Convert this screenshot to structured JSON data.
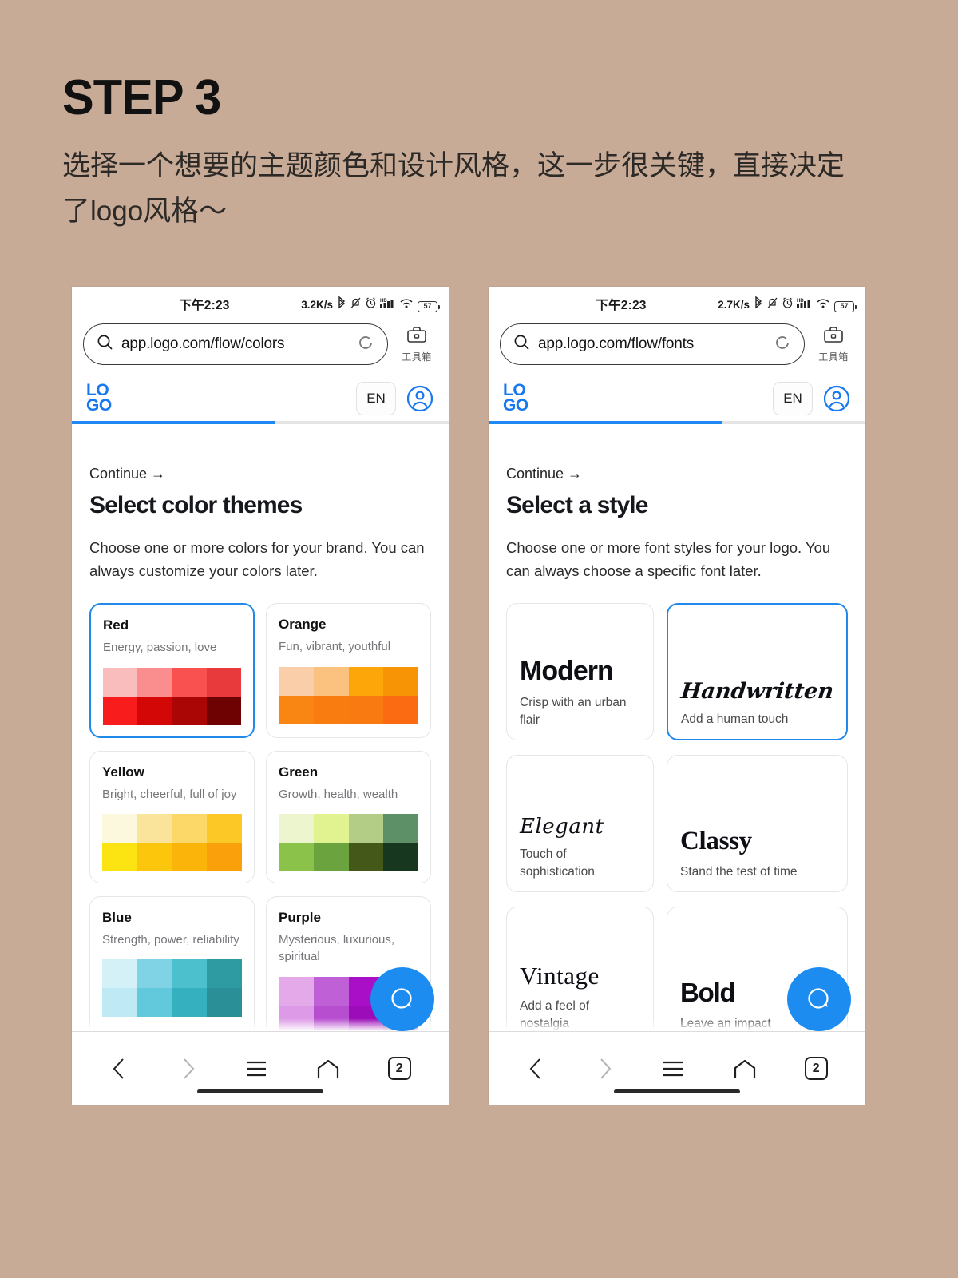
{
  "hero": {
    "step": "STEP 3",
    "subtitle": "选择一个想要的主题颜色和设计风格，这一步很关键，直接决定了logo风格～"
  },
  "phone_left": {
    "status": {
      "time": "下午2:23",
      "net_speed": "3.2K/s",
      "battery": "57",
      "hd_label": "HD"
    },
    "browser": {
      "url": "app.logo.com/flow/colors",
      "toolbox_label": "工具箱"
    },
    "app_header": {
      "logo_top": "LO",
      "logo_bottom": "GO",
      "lang": "EN"
    },
    "progress_percent": 54,
    "accent_color": "#1f88f2",
    "page": {
      "continue_label": "Continue →",
      "title": "Select color themes",
      "description": "Choose one or more colors for your brand. You can always customize your colors later."
    },
    "color_cards": [
      {
        "name": "Red",
        "desc": "Energy, passion, love",
        "selected": true,
        "swatches": [
          "#f9bdbd",
          "#fa8e8e",
          "#f9514f",
          "#e8393c",
          "#f81c1c",
          "#d40707",
          "#ab0606",
          "#6e0202"
        ]
      },
      {
        "name": "Orange",
        "desc": "Fun, vibrant, youthful",
        "selected": false,
        "swatches": [
          "#f9ceа8",
          "#fbc27f",
          "#fca60a",
          "#f79406",
          "#f98612",
          "#f97c10",
          "#fa7a12",
          "#fb6b12"
        ]
      },
      {
        "name": "Yellow",
        "desc": "Bright, cheerful, full of joy",
        "selected": false,
        "swatches": [
          "#fbf8dd",
          "#fae39a",
          "#fbd868",
          "#fbc825",
          "#fbe411",
          "#fcc60c",
          "#fbb50a",
          "#faa00a"
        ]
      },
      {
        "name": "Green",
        "desc": "Growth, health, wealth",
        "selected": false,
        "swatches": [
          "#edf5cf",
          "#e1f391",
          "#b4cd86",
          "#5e9067",
          "#8bc council",
          "#6ba33f",
          "#44581a",
          "#17371f"
        ]
      },
      {
        "name": "Blue",
        "desc": "Strength, power, reliability",
        "selected": false,
        "swatches": [
          "#d5f1f8",
          "#7fd3e5",
          "#4cc0cd",
          "#2e9aa2",
          "#bfe9f4",
          "#62c9dd",
          "#34b0be",
          "#2b8f98"
        ]
      },
      {
        "name": "Purple",
        "desc": "Mysterious, luxurious, spiritual",
        "selected": false,
        "swatches": [
          "#e3a9e8",
          "#c060d6",
          "#a90fc6",
          "#7a0b9a",
          "#dd9ae6",
          "#b74ed0",
          "#9c0cb8",
          "#6c088c"
        ]
      }
    ],
    "navbar": {
      "back": "back-arrow",
      "forward": "forward-arrow",
      "menu": "menu",
      "home": "home",
      "tabs": "2"
    }
  },
  "phone_right": {
    "status": {
      "time": "下午2:23",
      "net_speed": "2.7K/s",
      "battery": "57",
      "hd_label": "HD"
    },
    "browser": {
      "url": "app.logo.com/flow/fonts",
      "toolbox_label": "工具箱"
    },
    "app_header": {
      "logo_top": "LO",
      "logo_bottom": "GO",
      "lang": "EN"
    },
    "progress_percent": 62,
    "accent_color": "#1f88f2",
    "page": {
      "continue_label": "Continue →",
      "title": "Select a style",
      "description": "Choose one or more font styles for your logo. You can always choose a specific font later."
    },
    "style_cards": [
      {
        "name": "Modern",
        "desc": "Crisp with an urban flair",
        "selected": false,
        "style": "modern"
      },
      {
        "name": "Handwritten",
        "desc": "Add a human touch",
        "selected": true,
        "style": "handwritten"
      },
      {
        "name": "Elegant",
        "desc": "Touch of sophistication",
        "selected": false,
        "style": "elegant"
      },
      {
        "name": "Classy",
        "desc": "Stand the test of time",
        "selected": false,
        "style": "classy"
      },
      {
        "name": "Vintage",
        "desc": "Add a feel of nostalgia",
        "selected": false,
        "style": "vintage"
      },
      {
        "name": "Bold",
        "desc": "Leave an impact",
        "selected": false,
        "style": "bold"
      }
    ],
    "navbar": {
      "back": "back-arrow",
      "forward": "forward-arrow",
      "menu": "menu",
      "home": "home",
      "tabs": "2"
    }
  }
}
